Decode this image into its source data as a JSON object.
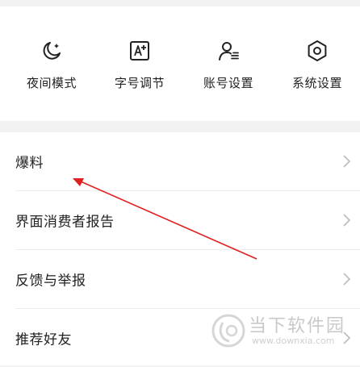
{
  "quick_actions": [
    {
      "label": "夜间模式",
      "icon": "moon-icon"
    },
    {
      "label": "字号调节",
      "icon": "font-size-icon"
    },
    {
      "label": "账号设置",
      "icon": "account-icon"
    },
    {
      "label": "系统设置",
      "icon": "settings-icon"
    }
  ],
  "menu": [
    {
      "label": "爆料"
    },
    {
      "label": "界面消费者报告"
    },
    {
      "label": "反馈与举报"
    },
    {
      "label": "推荐好友"
    }
  ],
  "annotation": {
    "color": "#e02020"
  },
  "watermark": {
    "title": "当下软件园",
    "url": "www.downxia.com"
  }
}
